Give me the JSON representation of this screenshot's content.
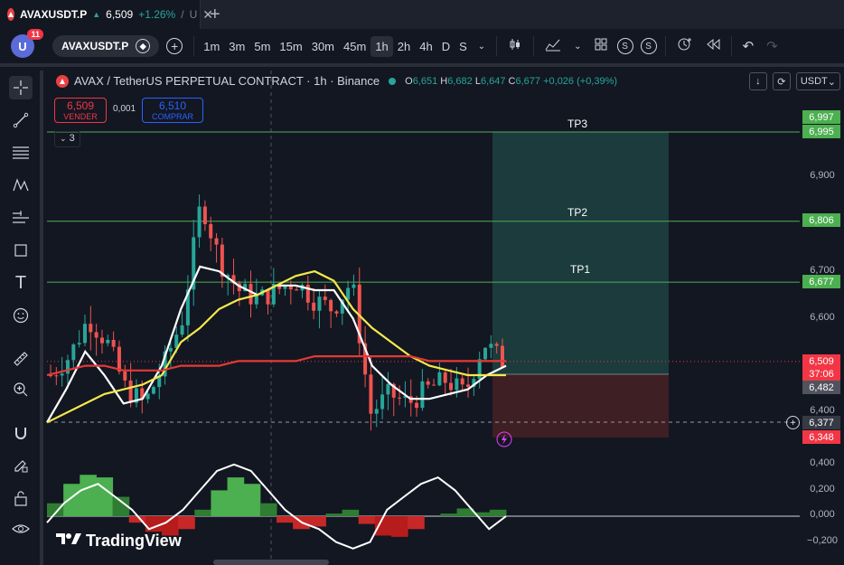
{
  "tab": {
    "title": "AVAXUSDT.P",
    "price": "6,509",
    "change": "+1.26%",
    "separator": "/",
    "extra": "U"
  },
  "toolbar": {
    "avatar_letter": "U",
    "notification_count": "11",
    "symbol": "AVAXUSDT.P",
    "intervals": [
      "1m",
      "3m",
      "5m",
      "15m",
      "30m",
      "45m",
      "1h",
      "2h",
      "4h",
      "D",
      "S"
    ],
    "active_interval": "1h"
  },
  "legend": {
    "title": "AVAX / TetherUS PERPETUAL CONTRACT · 1h · Binance",
    "o_label": "O",
    "o_val": "6,651",
    "h_label": "H",
    "h_val": "6,682",
    "l_label": "L",
    "l_val": "6,647",
    "c_label": "C",
    "c_val": "6,677",
    "change": "+0,026 (+0,39%)"
  },
  "trade": {
    "sell_price": "6,509",
    "sell_label": "VENDER",
    "spread": "0,001",
    "buy_price": "6,510",
    "buy_label": "COMPRAR"
  },
  "indicators_collapsed": "3",
  "currency": "USDT",
  "targets": {
    "tp1": "TP1",
    "tp2": "TP2",
    "tp3": "TP3"
  },
  "price_axis": {
    "labels": [
      "6,900",
      "6,700",
      "6,600",
      "6,400"
    ],
    "tag_6997": "6,997",
    "tag_6995": "6,995",
    "tag_6806": "6,806",
    "tag_6677": "6,677",
    "tag_6509": "6,509",
    "countdown": "37:06",
    "tag_6482": "6,482",
    "tag_6377": "6,377",
    "tag_6348": "6,348"
  },
  "osc_axis": {
    "labels": [
      "0,400",
      "0,200",
      "0,000",
      "−0,200"
    ]
  },
  "brand": "TradingView",
  "colors": {
    "background": "#131722",
    "up": "#26a69a",
    "down": "#ef5350",
    "tp_line": "#4caf50",
    "target_zone": "#1b3b3c",
    "stop_zone": "#3d1f24",
    "ma_white": "#ffffff",
    "ma_yellow": "#f5e94a",
    "ma_red": "#e53935"
  },
  "chart_data": {
    "type": "line",
    "title": "AVAX / TetherUS PERPETUAL CONTRACT · 1h · Binance",
    "xlabel": "",
    "ylabel": "",
    "ylim": [
      6.3,
      7.05
    ],
    "series": [
      {
        "values": [
          6.48,
          6.52,
          6.6,
          6.55,
          6.45,
          6.42,
          6.5,
          6.6,
          6.85,
          6.72,
          6.66,
          6.64,
          6.66,
          6.68,
          6.64,
          6.62,
          6.68,
          6.4,
          6.44,
          6.42,
          6.45,
          6.47,
          6.44,
          6.55,
          6.51
        ]
      },
      {
        "values": [
          6.38,
          6.45,
          6.53,
          6.48,
          6.42,
          6.43,
          6.5,
          6.62,
          6.71,
          6.7,
          6.67,
          6.65,
          6.67,
          6.67,
          6.66,
          6.66,
          6.6,
          6.5,
          6.46,
          6.43,
          6.43,
          6.44,
          6.45,
          6.48,
          6.5
        ]
      },
      {
        "values": [
          6.38,
          6.4,
          6.42,
          6.44,
          6.45,
          6.46,
          6.48,
          6.55,
          6.58,
          6.62,
          6.64,
          6.65,
          6.67,
          6.69,
          6.7,
          6.68,
          6.62,
          6.58,
          6.55,
          6.52,
          6.5,
          6.49,
          6.48,
          6.48,
          6.48
        ]
      },
      {
        "values": [
          6.48,
          6.49,
          6.5,
          6.5,
          6.49,
          6.49,
          6.49,
          6.5,
          6.5,
          6.5,
          6.51,
          6.51,
          6.51,
          6.51,
          6.52,
          6.52,
          6.52,
          6.52,
          6.52,
          6.52,
          6.51,
          6.51,
          6.51,
          6.51,
          6.51
        ]
      }
    ],
    "levels": {
      "tp3": 6.995,
      "tp2": 6.806,
      "tp1": 6.677,
      "entry": 6.482,
      "stop": 6.348,
      "last": 6.509
    }
  }
}
